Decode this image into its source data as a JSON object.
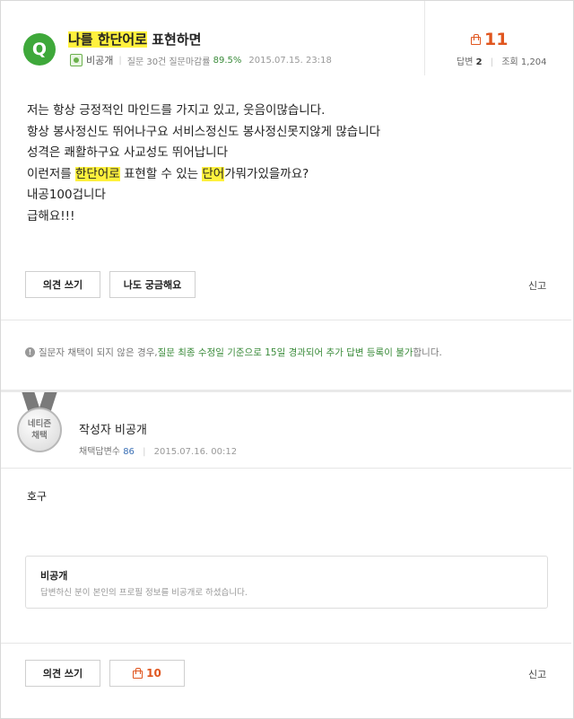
{
  "question": {
    "badge": "Q",
    "title_parts": [
      {
        "text": "나를 한단어로",
        "highlight": true
      },
      {
        "text": " 표현하면",
        "highlight": false
      }
    ],
    "author": "비공개",
    "stat_label": "질문 30건 질문마감률",
    "stat_value": "89.5%",
    "date": "2015.07.15. 23:18",
    "up_count": "11",
    "answers_label": "답변",
    "answers_value": "2",
    "views_label": "조회",
    "views_value": "1,204",
    "body_lines": [
      [
        {
          "text": "저는 항상 긍정적인 마인드를 가지고 있고, 웃음이많습니다.",
          "highlight": false
        }
      ],
      [
        {
          "text": "항상 봉사정신도 뛰어나구요 서비스정신도 봉사정신못지않게 많습니다",
          "highlight": false
        }
      ],
      [
        {
          "text": "성격은 쾌활하구요 사교성도 뛰어납니다",
          "highlight": false
        }
      ],
      [
        {
          "text": "이런저를 ",
          "highlight": false
        },
        {
          "text": "한단어로",
          "highlight": true
        },
        {
          "text": " 표현할 수 있는 ",
          "highlight": false
        },
        {
          "text": "단어",
          "highlight": true
        },
        {
          "text": "가뭐가있을까요?",
          "highlight": false
        }
      ],
      [
        {
          "text": "내공100겁니다",
          "highlight": false
        }
      ],
      [
        {
          "text": "급해요!!!",
          "highlight": false
        }
      ]
    ],
    "opinion_button": "의견 쓰기",
    "curious_button": "나도 궁금해요",
    "report": "신고"
  },
  "notice": {
    "prefix": "질문자 채택이 되지 않은 경우, ",
    "highlight": "질문 최종 수정일 기준으로 15일 경과되어 추가 답변 등록이 불가",
    "suffix": "합니다."
  },
  "answer": {
    "medal_line1": "네티즌",
    "medal_line2": "채택",
    "author": "작성자 비공개",
    "adopted_label": "채택답변수",
    "adopted_value": "86",
    "date": "2015.07.16. 00:12",
    "body": "호구",
    "profile_name": "비공개",
    "profile_desc": "답변하신 분이 본인의 프로필 정보를 비공개로 하셨습니다.",
    "opinion_button": "의견 쓰기",
    "vote_count": "10",
    "report": "신고"
  },
  "colors": {
    "accent_green": "#3ea83a",
    "highlight_yellow": "#fff13d",
    "vote_orange": "#e0561f"
  }
}
